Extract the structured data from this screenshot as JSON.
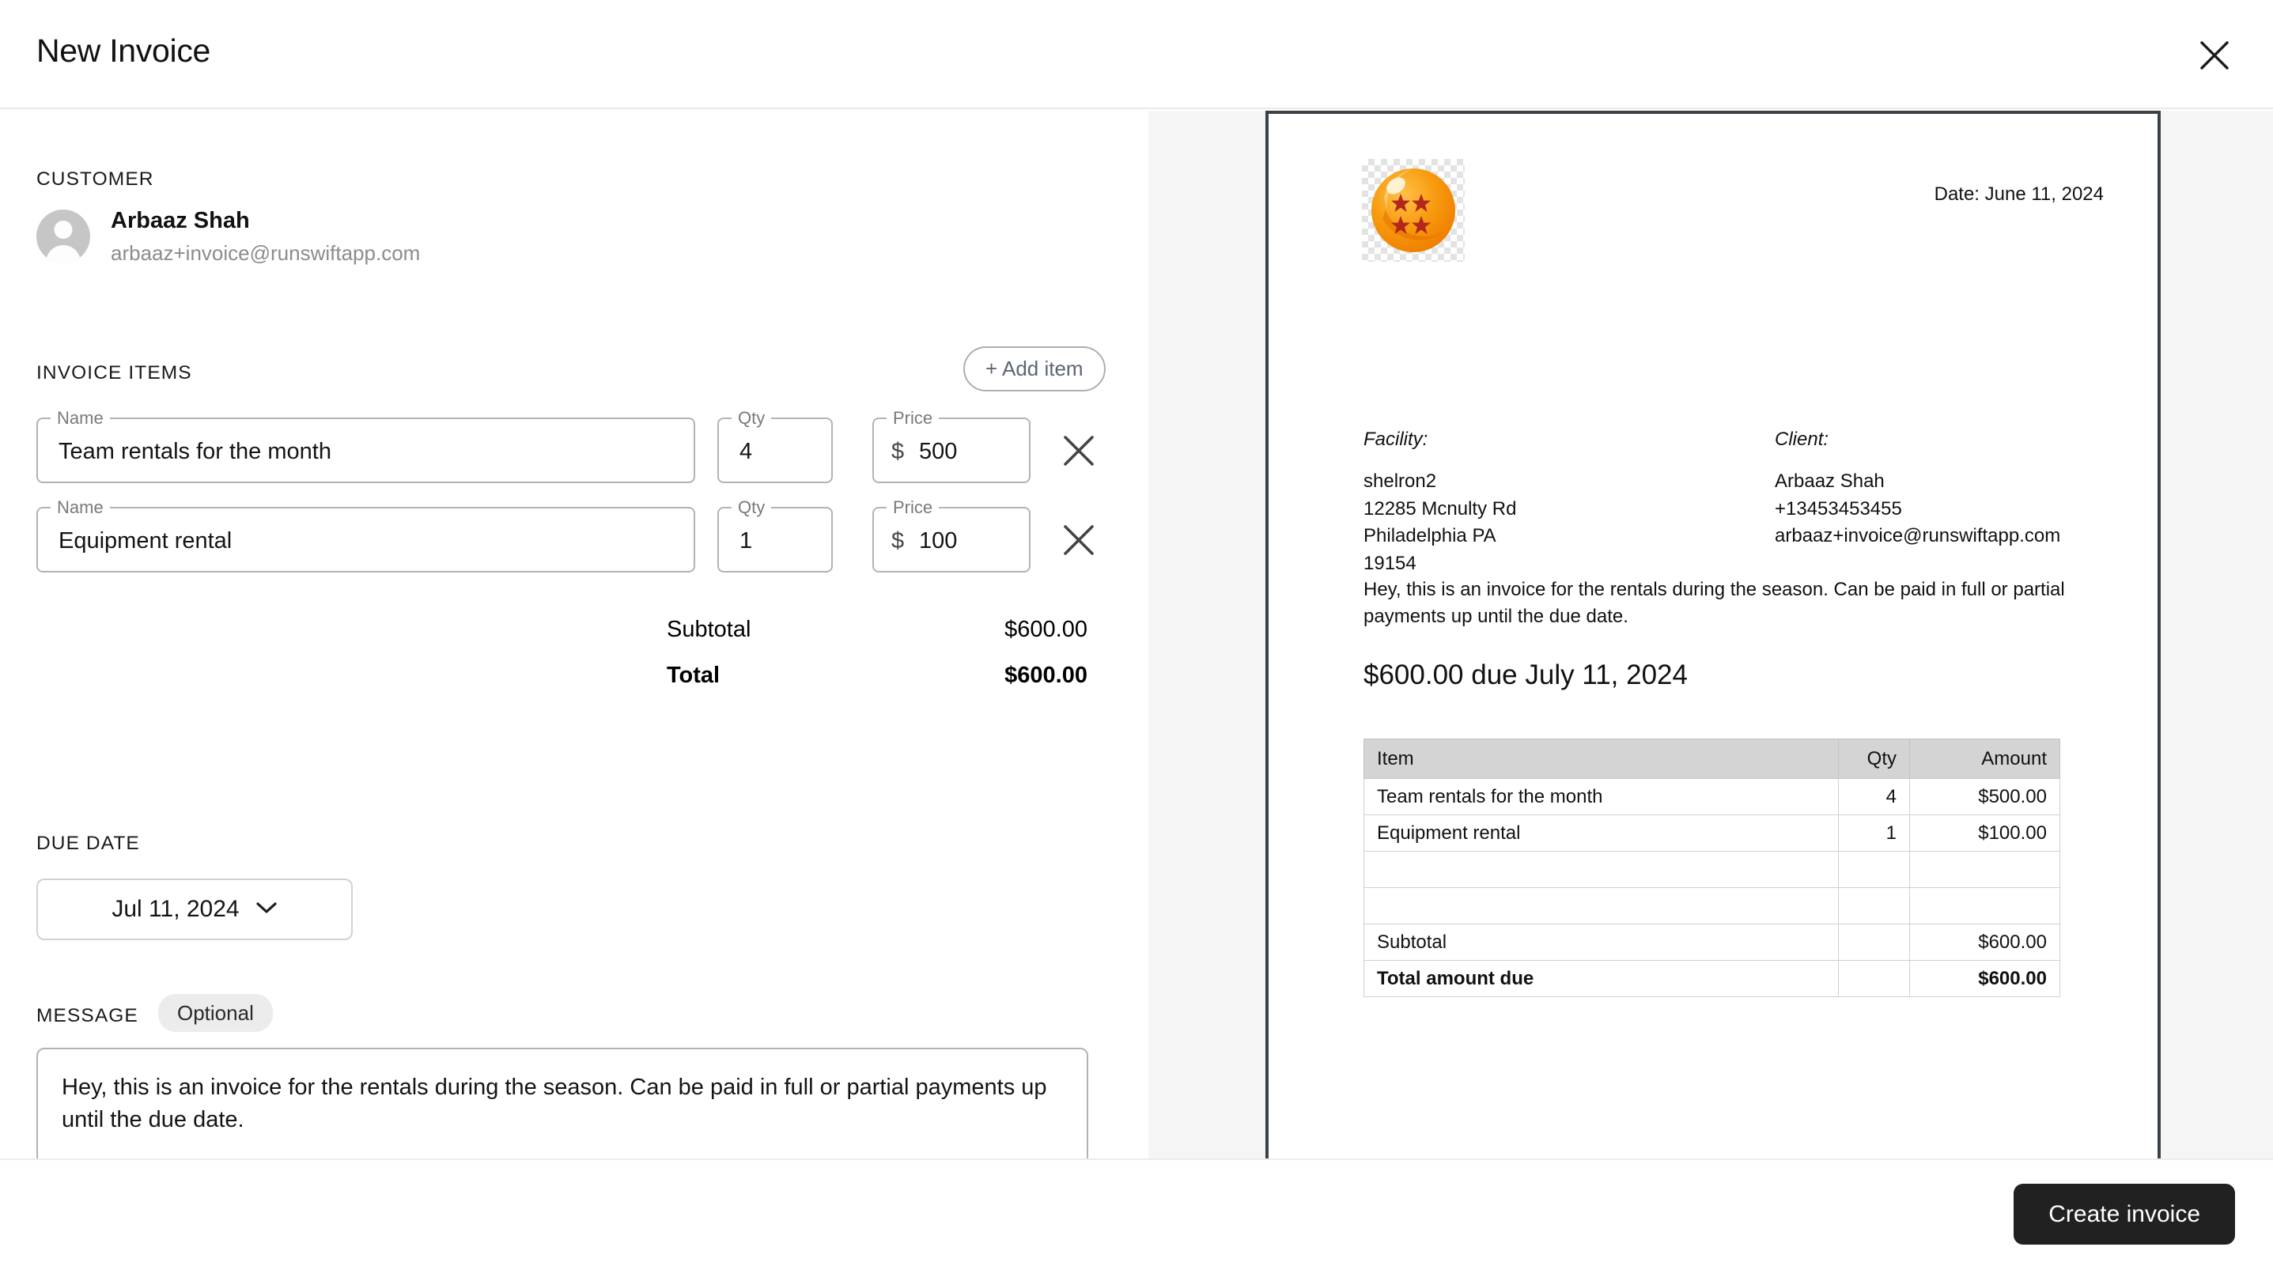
{
  "header": {
    "title": "New Invoice",
    "close_icon": "close-icon"
  },
  "customer": {
    "section_label": "CUSTOMER",
    "name": "Arbaaz Shah",
    "email": "arbaaz+invoice@runswiftapp.com"
  },
  "invoice_items": {
    "section_label": "INVOICE ITEMS",
    "add_item_label": "+ Add item",
    "name_field_label": "Name",
    "qty_field_label": "Qty",
    "price_field_label": "Price",
    "currency_symbol": "$",
    "rows": [
      {
        "name": "Team rentals for the month",
        "qty": "4",
        "price": "500"
      },
      {
        "name": "Equipment rental",
        "qty": "1",
        "price": "100"
      }
    ],
    "subtotal_label": "Subtotal",
    "subtotal_value": "$600.00",
    "total_label": "Total",
    "total_value": "$600.00"
  },
  "due_date": {
    "section_label": "DUE DATE",
    "value": "Jul 11, 2024",
    "chevron_icon": "chevron-down-icon"
  },
  "message": {
    "section_label": "MESSAGE",
    "badge": "Optional",
    "value": "Hey, this is an invoice for the rentals during the season. Can be paid in full or partial payments up until the due date."
  },
  "preview": {
    "logo_icon": "dragonball-logo-icon",
    "date": "Date: June 11, 2024",
    "facility_title": "Facility:",
    "facility_lines": [
      "shelron2",
      "12285 Mcnulty Rd",
      "Philadelphia PA",
      "19154"
    ],
    "client_title": "Client:",
    "client_lines": [
      "Arbaaz Shah",
      "+13453453455",
      "arbaaz+invoice@runswiftapp.com"
    ],
    "note": "Hey, this is an invoice for the rentals during the season. Can be paid in full or partial payments up until the due date.",
    "due_heading": "$600.00 due July 11, 2024",
    "table": {
      "headers": [
        "Item",
        "Qty",
        "Amount"
      ],
      "rows": [
        {
          "item": "Team rentals for the month",
          "qty": "4",
          "amount": "$500.00"
        },
        {
          "item": "Equipment rental",
          "qty": "1",
          "amount": "$100.00"
        },
        {
          "item": "",
          "qty": "",
          "amount": ""
        },
        {
          "item": "",
          "qty": "",
          "amount": ""
        }
      ],
      "subtotal_label": "Subtotal",
      "subtotal_value": "$600.00",
      "total_label": "Total amount due",
      "total_value": "$600.00"
    }
  },
  "footer": {
    "create_label": "Create invoice"
  },
  "colors": {
    "accent_dark": "#212121",
    "logo_orange": "#f5a623",
    "logo_star": "#b3261a",
    "panel_bg": "#f5f5f5",
    "table_header": "#d4d4d4"
  }
}
